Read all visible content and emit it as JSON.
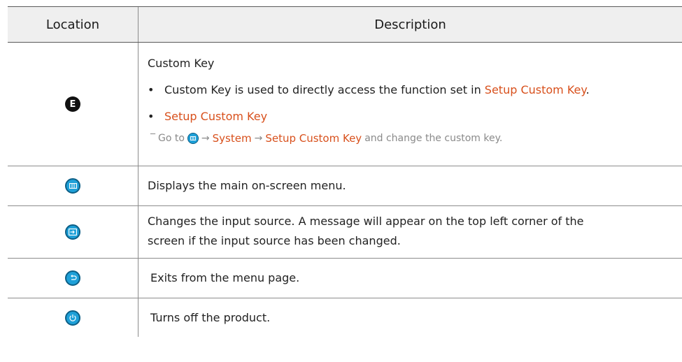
{
  "table": {
    "headers": {
      "location": "Location",
      "description": "Description"
    },
    "row1": {
      "location_label": "E",
      "title": "Custom Key",
      "bullet1_prefix": "Custom Key is used to directly access the function set in ",
      "bullet1_link": "Setup Custom Key",
      "bullet1_suffix": ".",
      "bullet2": "Setup Custom Key",
      "note_dash": "‾",
      "note_goto": "Go to",
      "note_arrow1": "→",
      "note_system": "System",
      "note_arrow2": "→",
      "note_setup": "Setup Custom Key",
      "note_end": "and change the custom key."
    },
    "row2": {
      "description": "Displays the main on-screen menu."
    },
    "row3": {
      "description_line1": "Changes the input source. A message will appear on the top left corner of the",
      "description_line2": "screen if the input source has been changed."
    },
    "row4": {
      "description": "Exits from the menu page."
    },
    "row5": {
      "description": "Turns off the product."
    }
  },
  "colors": {
    "accent": "#d8501c",
    "icon_blue": "#1ea0d8"
  },
  "icons": [
    "e-button-icon",
    "menu-icon",
    "source-icon",
    "return-icon",
    "power-icon"
  ]
}
